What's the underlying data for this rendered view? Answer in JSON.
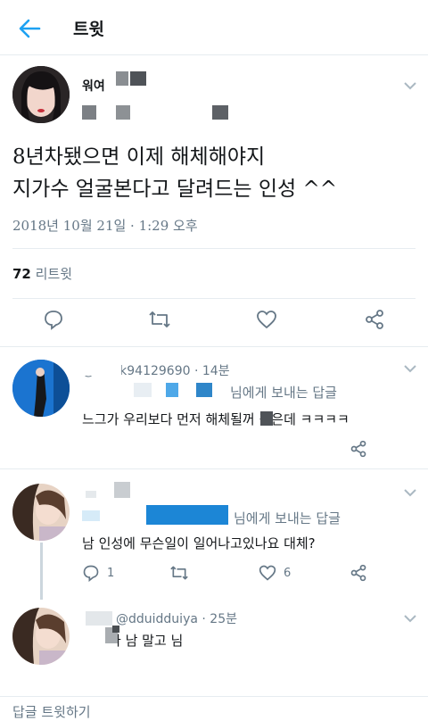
{
  "header": {
    "title": "트윗"
  },
  "main_tweet": {
    "author_name": "워여",
    "text_line1": "8년차됐으면 이제 해체해야지",
    "text_line2": "지가수 얼굴본다고 달려드는 인성 ^^",
    "timestamp": "2018년 10월 21일 · 1:29 오후",
    "retweet_count": "72",
    "retweet_label": "리트윗"
  },
  "replies": [
    {
      "handle": "@chick94129690 · 14분",
      "reply_to": "님에게 보내는 답글",
      "text": "느그가 우리보다 먼저 해체될꺼 같은데 ㅋㅋㅋㅋ"
    },
    {
      "handle": "",
      "reply_to": "님에게 보내는 답글",
      "text": "남 인성에 무슨일이 일어나고있나요 대체?",
      "reply_count": "1",
      "like_count": "6"
    },
    {
      "handle": "@dduidduiya · 25분",
      "text": "나 남 말고 님"
    }
  ],
  "compose": {
    "placeholder": "답글 트윗하기"
  },
  "colors": {
    "accent": "#1da1f2",
    "secondary_text": "#657786",
    "divider": "#e6ecf0"
  },
  "icons": [
    "back-arrow-icon",
    "chevron-down-icon",
    "reply-icon",
    "retweet-icon",
    "like-icon",
    "share-icon"
  ]
}
